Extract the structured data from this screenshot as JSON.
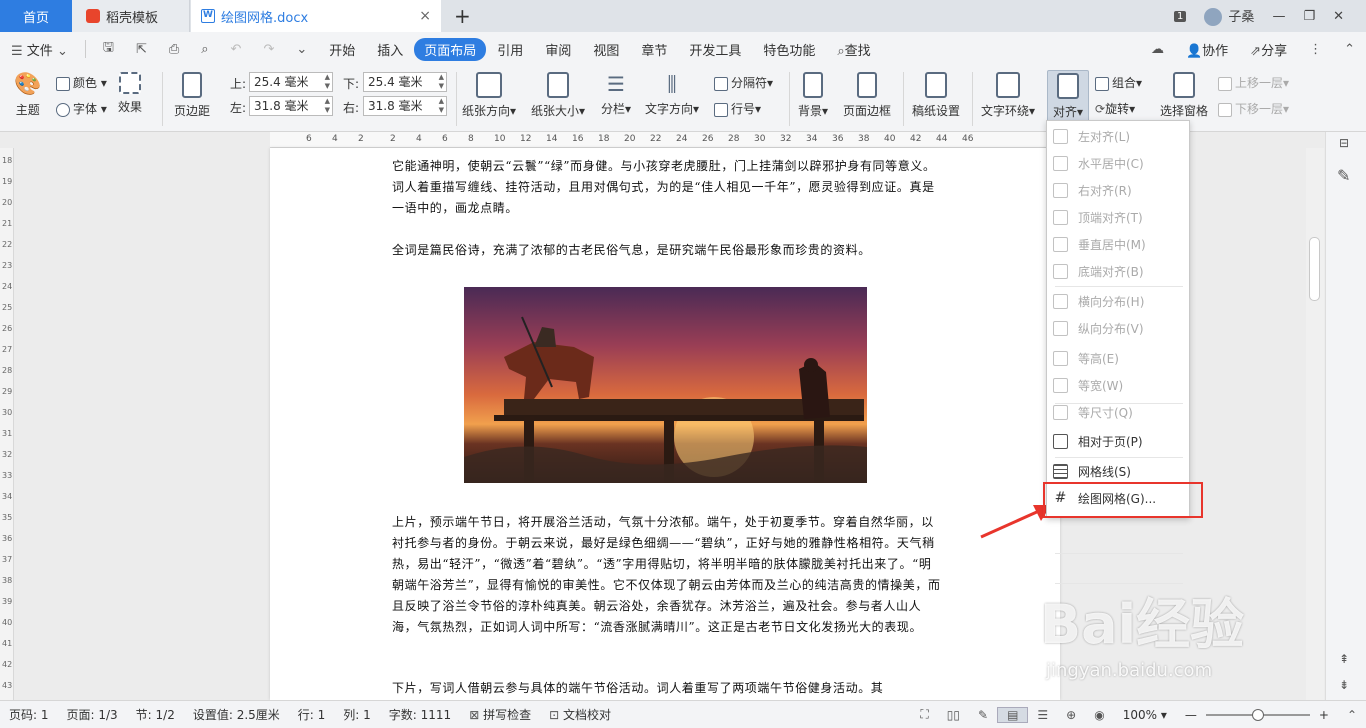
{
  "tabs": {
    "home": "首页",
    "template": "稻壳模板",
    "document": "绘图网格.docx",
    "new_tab": "+",
    "close": "×"
  },
  "title_right": {
    "badge": "1",
    "user": "子桑",
    "min": "—",
    "restore": "❐",
    "close": "✕"
  },
  "menu": {
    "file": "文件",
    "items": [
      "开始",
      "插入",
      "页面布局",
      "引用",
      "审阅",
      "视图",
      "章节",
      "开发工具",
      "特色功能"
    ],
    "active": "页面布局",
    "search": "查找",
    "collab": "协作",
    "share": "分享"
  },
  "ribbon": {
    "color": "颜色",
    "theme": "主题",
    "font": "字体",
    "effect": "效果",
    "margin": "页边距",
    "top_label": "上:",
    "top_value": "25.4 毫米",
    "bottom_label": "下:",
    "bottom_value": "25.4 毫米",
    "left_label": "左:",
    "left_value": "31.8 毫米",
    "right_label": "右:",
    "right_value": "31.8 毫米",
    "orientation": "纸张方向",
    "size": "纸张大小",
    "columns": "分栏",
    "text_dir": "文字方向",
    "separator": "分隔符",
    "line_num": "行号",
    "background": "背景",
    "border": "页面边框",
    "draft": "稿纸设置",
    "wrap": "文字环绕",
    "align": "对齐",
    "group": "组合",
    "rotate": "旋转",
    "select_pane": "选择窗格",
    "up_layer": "上移一层",
    "down_layer": "下移一层"
  },
  "ruler": [
    "6",
    "4",
    "2",
    "2",
    "4",
    "6",
    "8",
    "10",
    "12",
    "14",
    "16",
    "18",
    "20",
    "22",
    "24",
    "26",
    "28",
    "30",
    "32",
    "34",
    "36",
    "38",
    "40",
    "42",
    "44",
    "46"
  ],
  "vruler": [
    "18",
    "19",
    "20",
    "21",
    "22",
    "23",
    "24",
    "25",
    "26",
    "27",
    "28",
    "29",
    "30",
    "31",
    "32",
    "33",
    "34",
    "35",
    "36",
    "37",
    "38",
    "39",
    "40",
    "41",
    "42",
    "43"
  ],
  "document": {
    "p1": "它能通神明，使朝云“云鬟”“绿”而身健。与小孩穿老虎腰肚，门上挂蒲剑以辟邪护身有同等意义。词人着重描写缠线、挂符活动，且用对偶句式，为的是“佳人相见一千年”，愿灵验得到应证。真是一语中的，画龙点睛。",
    "p2": "全词是篇民俗诗，充满了浓郁的古老民俗气息，是研究端午民俗最形象而珍贵的资料。",
    "p3": "上片，预示端午节日，将开展浴兰活动，气氛十分浓郁。端午，处于初夏季节。穿着自然华丽，以衬托参与者的身份。于朝云来说，最好是绿色细绸——“碧纨”，正好与她的雅静性格相符。天气稍热，易出“轻汗”，“微透”着“碧纨”。“透”字用得贴切，将半明半暗的肤体朦胧美衬托出来了。“明朝端午浴芳兰”，显得有愉悦的审美性。它不仅体现了朝云由芳体而及兰心的纯洁高贵的情操美，而且反映了浴兰令节俗的淳朴纯真美。朝云浴处，余香犹存。沐芳浴兰，遍及社会。参与者人山人海，气氛热烈，正如词人词中所写：“流香涨腻满晴川”。这正是古老节日文化发扬光大的表现。",
    "p4": "下片，写词人借朝云参与具体的端午节俗活动。词人着重写了两项端午节俗健身活动。其"
  },
  "align_menu": [
    {
      "label": "左对齐(L)",
      "enabled": false,
      "icon": "align-left-icon"
    },
    {
      "label": "水平居中(C)",
      "enabled": false,
      "icon": "align-center-icon"
    },
    {
      "label": "右对齐(R)",
      "enabled": false,
      "icon": "align-right-icon"
    },
    {
      "label": "顶端对齐(T)",
      "enabled": false,
      "icon": "align-top-icon"
    },
    {
      "label": "垂直居中(M)",
      "enabled": false,
      "icon": "align-middle-icon"
    },
    {
      "label": "底端对齐(B)",
      "enabled": false,
      "icon": "align-bottom-icon"
    },
    {
      "label": "横向分布(H)",
      "enabled": false,
      "icon": "distribute-h-icon"
    },
    {
      "label": "纵向分布(V)",
      "enabled": false,
      "icon": "distribute-v-icon"
    },
    {
      "label": "等高(E)",
      "enabled": false,
      "icon": "same-height-icon"
    },
    {
      "label": "等宽(W)",
      "enabled": false,
      "icon": "same-width-icon"
    },
    {
      "label": "等尺寸(Q)",
      "enabled": false,
      "icon": "same-size-icon"
    },
    {
      "label": "相对于页(P)",
      "enabled": true,
      "icon": "relative-page-icon"
    },
    {
      "label": "网格线(S)",
      "enabled": true,
      "icon": "gridlines-icon"
    },
    {
      "label": "绘图网格(G)...",
      "enabled": true,
      "icon": "drawing-grid-icon"
    }
  ],
  "status": {
    "page_num": "页码: 1",
    "pages": "页面: 1/3",
    "section": "节: 1/2",
    "setting": "设置值: 2.5厘米",
    "row": "行: 1",
    "col": "列: 1",
    "words": "字数: 1111",
    "spell": "拼写检查",
    "proof": "文档校对",
    "zoom": "100%"
  },
  "watermark": {
    "main": "Bai经验",
    "sub": "jingyan.baidu.com"
  },
  "colors": {
    "accent": "#2e7de1",
    "highlight": "#e8352c"
  }
}
